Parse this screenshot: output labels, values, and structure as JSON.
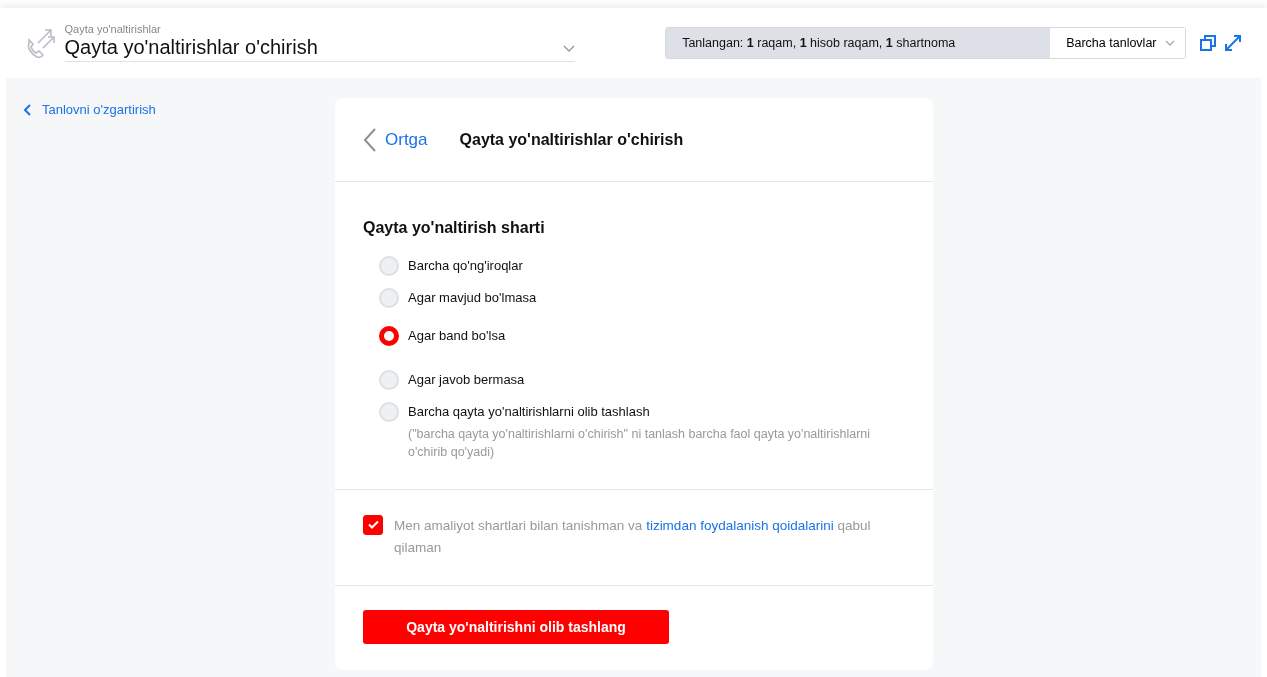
{
  "header": {
    "caption": "Qayta yo'naltirishlar",
    "title": "Qayta yo'naltirishlar o'chirish",
    "selection": {
      "label": "Tanlangan: ",
      "parts": [
        {
          "count": "1",
          "text": " raqam, "
        },
        {
          "count": "1",
          "text": " hisob raqam, "
        },
        {
          "count": "1",
          "text": " shartnoma"
        }
      ]
    },
    "selector": "Barcha tanlovlar"
  },
  "side_link": "Tanlovni o'zgartirish",
  "card": {
    "back": "Ortga",
    "title": "Qayta yo'naltirishlar o'chirish",
    "section": "Qayta yo'naltirish sharti",
    "options": [
      {
        "label": "Barcha qo'ng'iroqlar",
        "selected": false
      },
      {
        "label": "Agar mavjud bo'lmasa",
        "selected": false
      },
      {
        "label": "Agar band bo'lsa",
        "selected": true
      },
      {
        "label": "Agar javob bermasa",
        "selected": false
      },
      {
        "label": "Barcha qayta yo'naltirishlarni olib tashlash",
        "selected": false,
        "note": "(\"barcha qayta yo'naltirishlarni o'chirish\" ni tanlash barcha faol qayta yo'naltirishlarni o'chirib qo'yadi)"
      }
    ],
    "agreement": {
      "checked": true,
      "before": "Men amaliyot shartlari bilan tanishman va ",
      "link": "tizimdan foydalanish qoidalarini",
      "after": " qabul qilaman"
    },
    "submit": "Qayta yo'naltirishni olib tashlang"
  }
}
